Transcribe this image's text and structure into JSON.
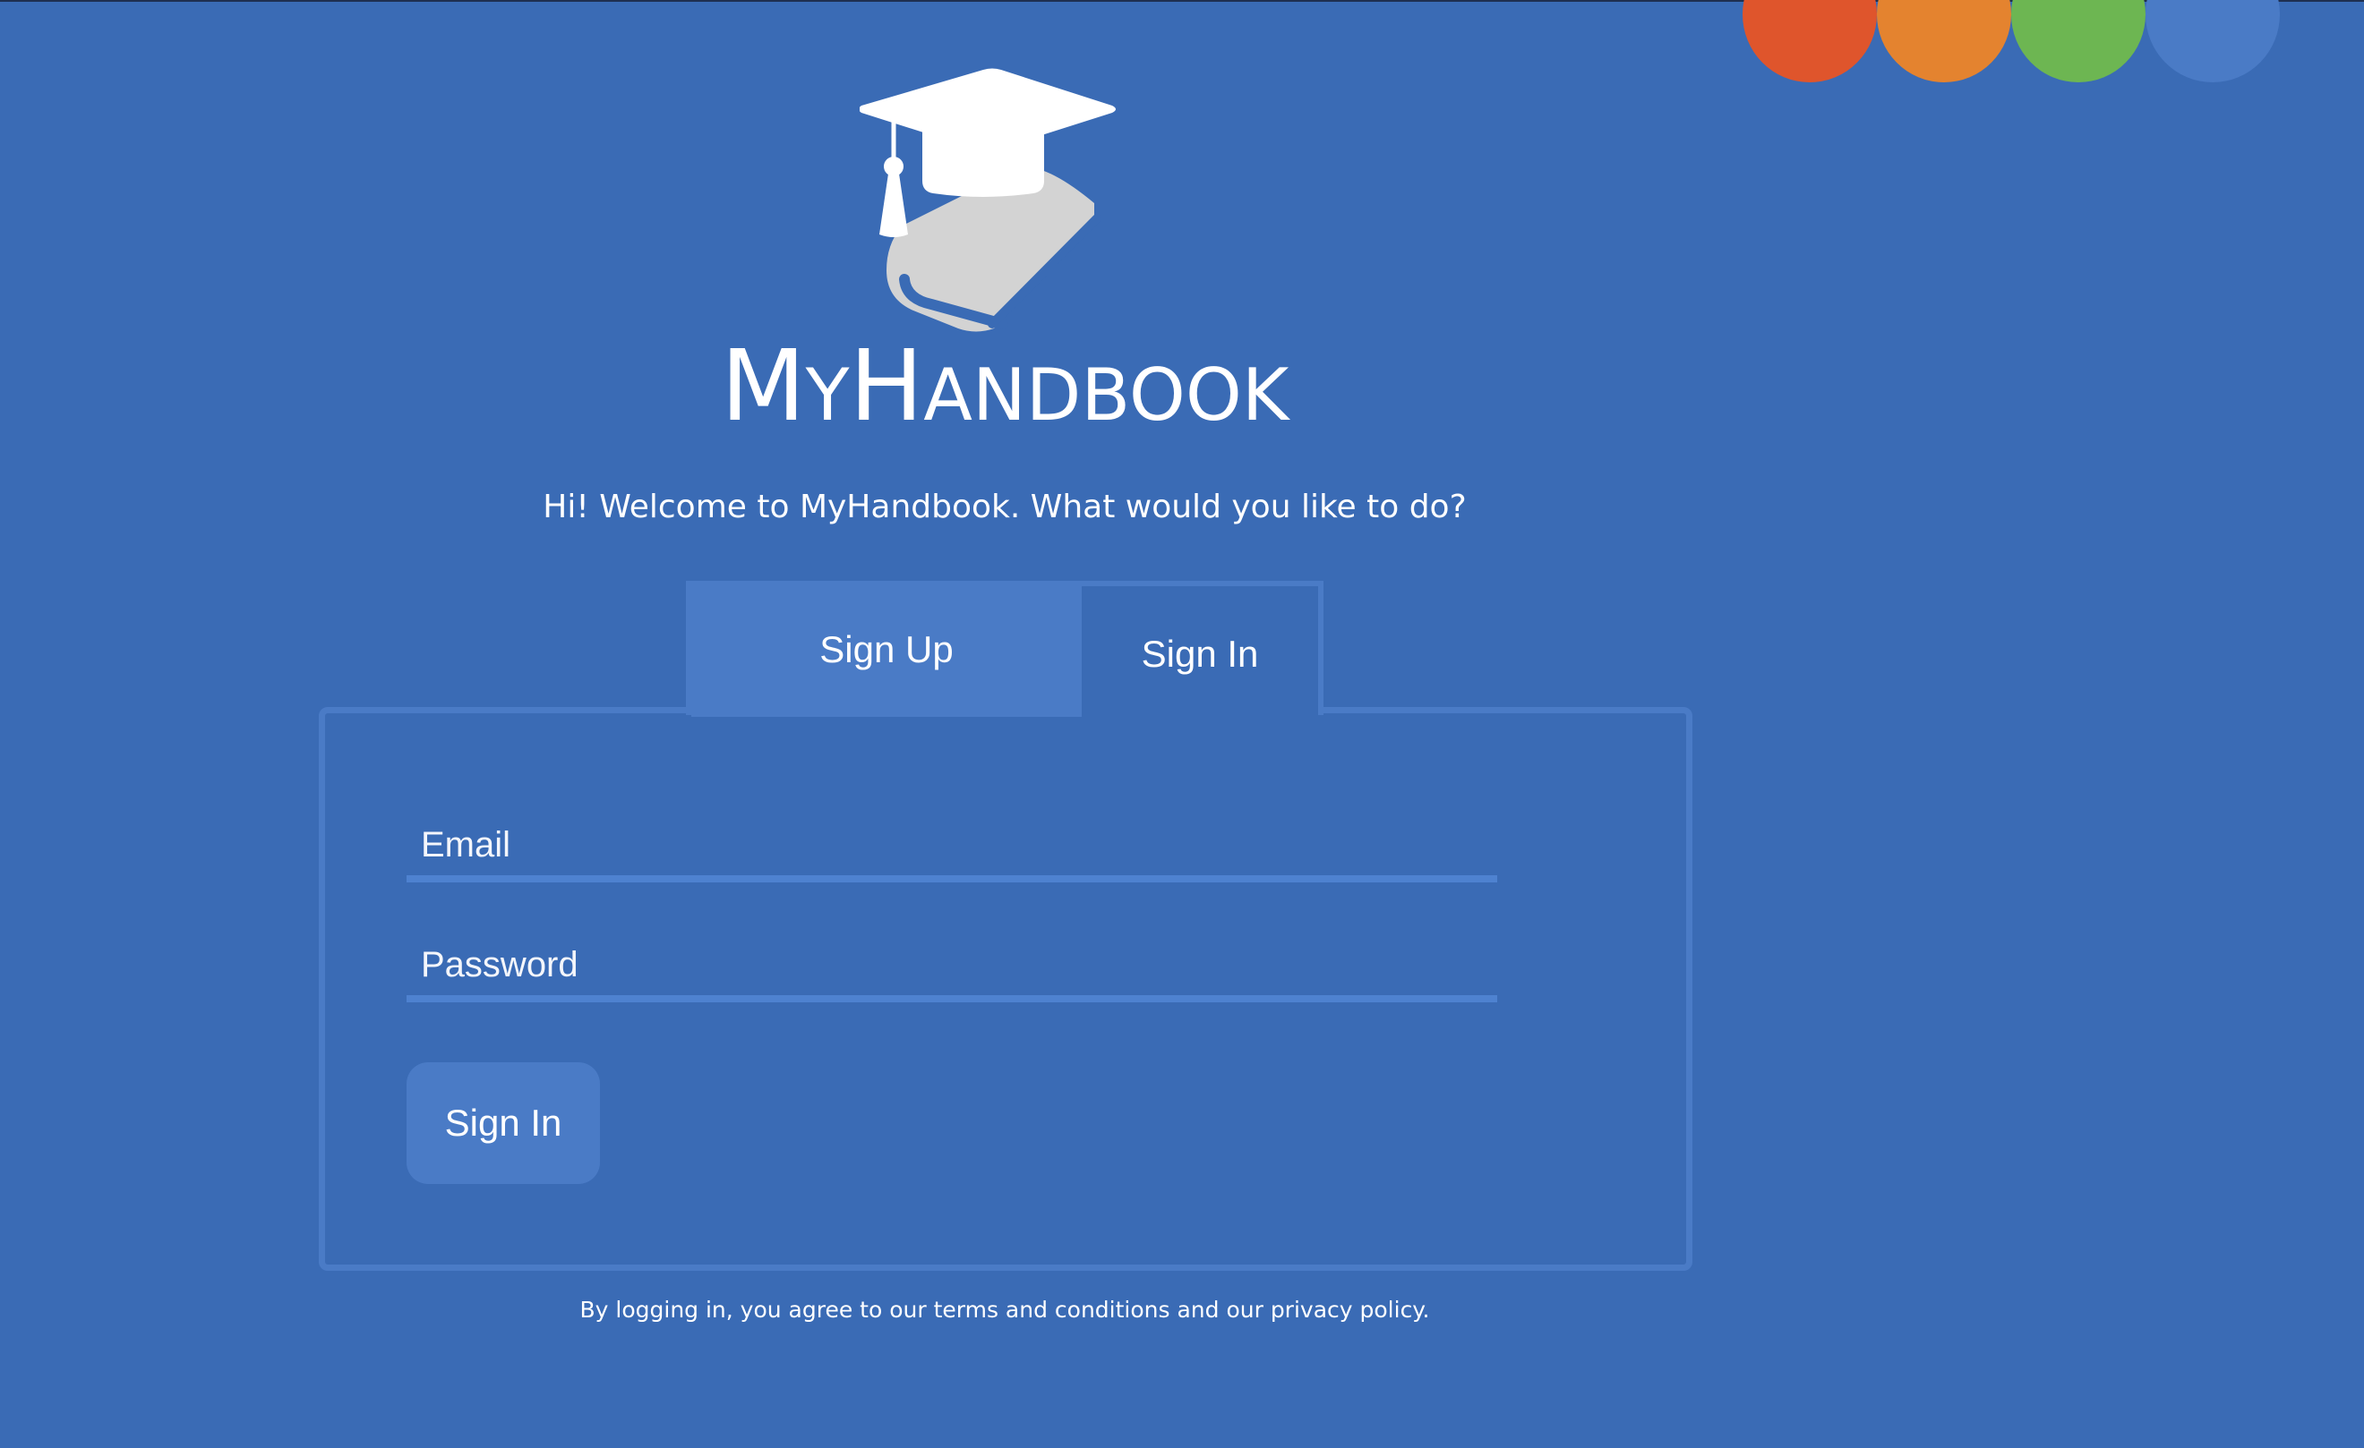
{
  "theme": {
    "background": "#3a6bb5",
    "accent": "#4a7bc6",
    "dots": [
      "#df552c",
      "#e4832f",
      "#6db652",
      "#4a7bc6"
    ]
  },
  "logo": {
    "icon": "graduation-cap-book-icon",
    "name_parts": [
      {
        "text": "M",
        "size": "big"
      },
      {
        "text": "Y",
        "size": "small"
      },
      {
        "text": "H",
        "size": "big"
      },
      {
        "text": "ANDBOOK",
        "size": "small"
      }
    ]
  },
  "welcome_text": "Hi! Welcome to MyHandbook. What would you like to do?",
  "tabs": {
    "sign_up": "Sign Up",
    "sign_in": "Sign In",
    "active": "sign_in"
  },
  "form": {
    "email_placeholder": "Email",
    "password_placeholder": "Password",
    "email_value": "",
    "password_value": "",
    "submit_label": "Sign In"
  },
  "footer": {
    "terms_text": "By logging in, you agree to our terms and conditions and our privacy policy."
  }
}
